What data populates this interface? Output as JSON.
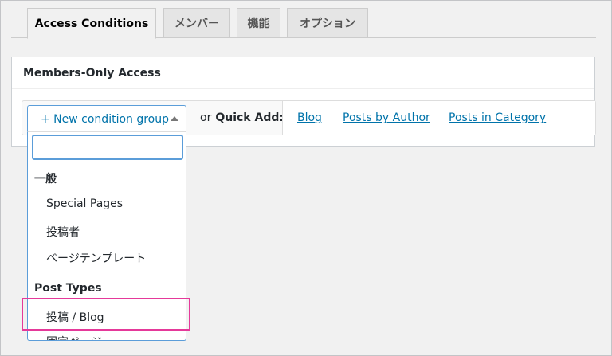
{
  "tabs": [
    {
      "label": "Access Conditions",
      "active": true
    },
    {
      "label": "メンバー",
      "active": false
    },
    {
      "label": "機能",
      "active": false
    },
    {
      "label": "オプション",
      "active": false
    }
  ],
  "panel": {
    "title": "Members-Only Access"
  },
  "condition": {
    "select_label": "+ New condition group",
    "quick_add_prefix": "or",
    "quick_add_label": "Quick Add:",
    "quick_links": [
      "Blog",
      "Posts by Author",
      "Posts in Category"
    ]
  },
  "dropdown": {
    "search_value": "",
    "groups": [
      {
        "label": "一般",
        "options": [
          "Special Pages",
          "投稿者",
          "ページテンプレート"
        ]
      },
      {
        "label": "Post Types",
        "options": [
          "投稿 / Blog",
          "固定ページ"
        ]
      }
    ]
  },
  "colors": {
    "link": "#0073aa",
    "focus": "#5b9dd9",
    "highlight": "#e5399a"
  }
}
